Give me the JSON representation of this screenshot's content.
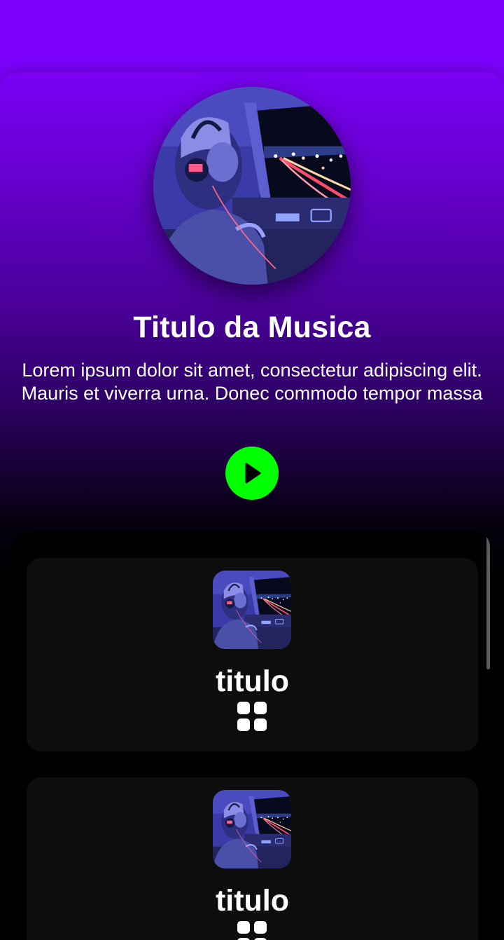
{
  "song": {
    "title": "Titulo da Musica",
    "description": "Lorem ipsum dolor sit amet, consectetur adipiscing elit. Mauris et viverra urna. Donec commodo tempor massa"
  },
  "controls": {
    "play_icon": "play-icon",
    "play_color": "#00ff00"
  },
  "playlist": {
    "items": [
      {
        "title": "titulo",
        "icon": "grid-icon"
      },
      {
        "title": "titulo",
        "icon": "grid-icon"
      }
    ]
  },
  "colors": {
    "accent": "#7b00fa",
    "play": "#00ff00",
    "list_bg": "#000000",
    "item_bg": "#0d0d0d"
  }
}
